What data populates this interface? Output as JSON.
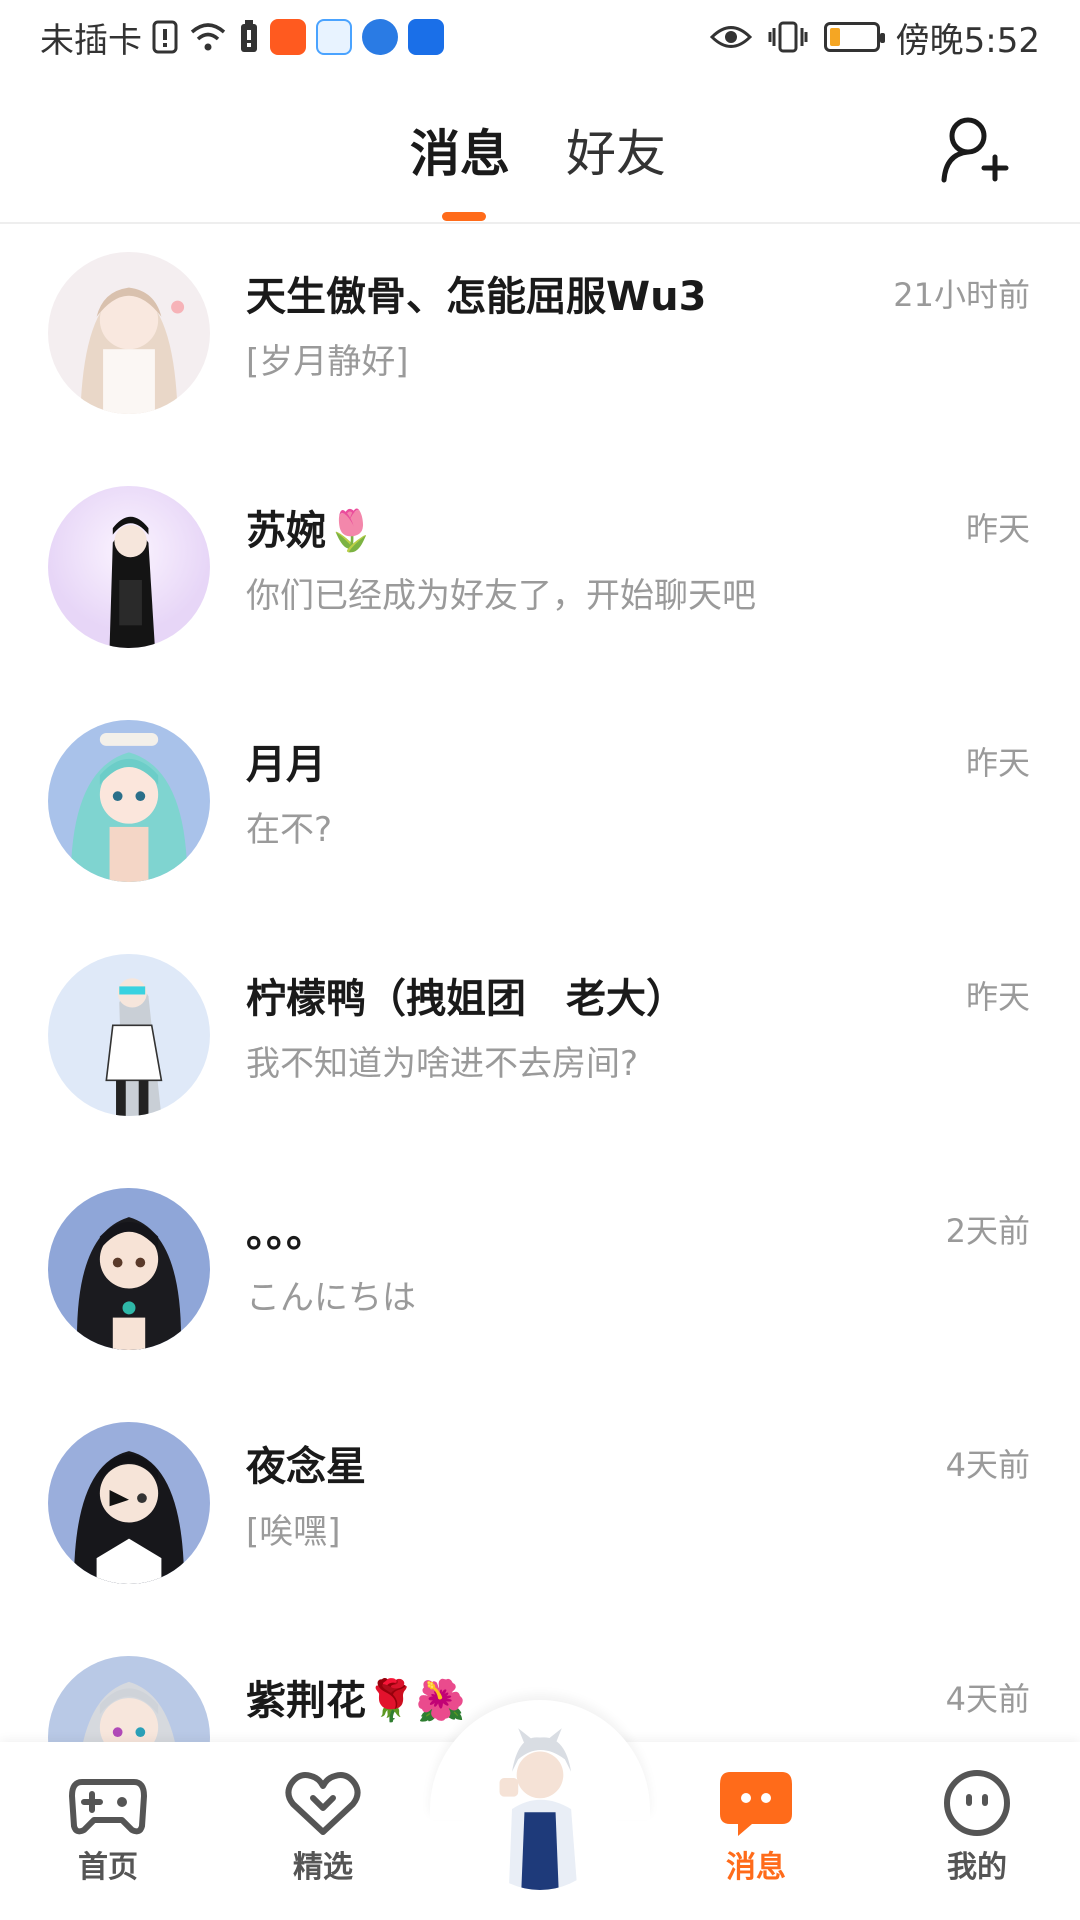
{
  "status_bar": {
    "carrier": "未插卡",
    "time": "傍晚5:52",
    "app_icons": [
      "bag-app-icon",
      "cloud-app-icon",
      "globe-app-icon",
      "bulb-app-icon"
    ],
    "battery_level": 0.2
  },
  "header": {
    "tabs": [
      {
        "label": "消息",
        "active": true
      },
      {
        "label": "好友",
        "active": false
      }
    ],
    "accent": "#ff6b1a"
  },
  "chats": [
    {
      "name": "天生傲骨、怎能屈服Wu3",
      "preview": "[岁月静好]",
      "time": "21小时前"
    },
    {
      "name": "苏婉🌷",
      "preview": "你们已经成为好友了，开始聊天吧",
      "time": "昨天"
    },
    {
      "name": "月月",
      "preview": "在不?",
      "time": "昨天"
    },
    {
      "name": "柠檬鸭（拽姐团　老大）",
      "preview": "我不知道为啥进不去房间?",
      "time": "昨天"
    },
    {
      "name": "。。。",
      "preview": "こんにちは",
      "time": "2天前"
    },
    {
      "name": "夜念星",
      "preview": "[唉嘿]",
      "time": "4天前"
    },
    {
      "name": "紫荆花🌹🌺",
      "preview": "",
      "time": "4天前"
    }
  ],
  "bottom_nav": [
    {
      "label": "首页",
      "icon": "gamepad-icon"
    },
    {
      "label": "精选",
      "icon": "heart-icon"
    },
    {
      "label": "消息",
      "icon": "chat-bubble-icon",
      "active": true
    },
    {
      "label": "我的",
      "icon": "smiley-icon"
    }
  ]
}
